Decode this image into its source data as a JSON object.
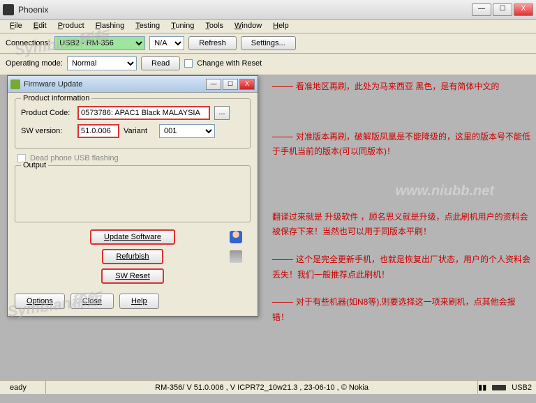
{
  "window": {
    "title": "Phoenix",
    "controls": {
      "min": "—",
      "max": "☐",
      "close": "X"
    }
  },
  "menu": [
    "File",
    "Edit",
    "Product",
    "Flashing",
    "Testing",
    "Tuning",
    "Tools",
    "Window",
    "Help"
  ],
  "toolbar": {
    "connections_label": "Connections:",
    "connections_value": "USB2 - RM-356",
    "na_value": "N/A",
    "refresh": "Refresh",
    "settings": "Settings...",
    "opmode_label": "Operating mode:",
    "opmode_value": "Normal",
    "read": "Read",
    "change_reset": "Change with Reset"
  },
  "dialog": {
    "title": "Firmware Update",
    "group_label": "Product information",
    "product_code_label": "Product Code:",
    "product_code_value": "0573786: APAC1 Black MALAYSIA",
    "sw_label": "SW version:",
    "sw_value": "51.0.006",
    "variant_label": "Variant",
    "variant_value": "001",
    "browse": "...",
    "dead_phone": "Dead phone USB flashing",
    "output_label": "Output",
    "update_btn": "Update Software",
    "refurbish_btn": "Refurbish",
    "swreset_btn": "SW Reset",
    "options_btn": "Options",
    "close_btn": "Close",
    "help_btn": "Help"
  },
  "annotations": {
    "a1": "看准地区再刷，此处为马来西亚 黑色，是有简体中文的",
    "a2": "对准版本再刷，破解版凤凰是不能降级的，这里的版本号不能低于手机当前的版本(可以同版本)！",
    "a3": "翻译过来就是 升级软件 ，顾名思义就是升级，点此刷机用户的资料会被保存下来！当然也可以用于同版本平刷！",
    "a4": "这个是完全更新手机，也就是恢复出厂状态，用户的个人资料会丢失！我们一般推荐点此刷机！",
    "a5": "对于有些机器(如N8等),则要选择这一项来刷机，点其他会报错！"
  },
  "watermark": {
    "text": "Symbian稀飯",
    "url": "www.niubb.net"
  },
  "status": {
    "ready": "eady",
    "info": "RM-356/ V 51.0.006 , V ICPR72_10w21.3 , 23-06-10 , © Nokia",
    "usb": "USB2"
  }
}
